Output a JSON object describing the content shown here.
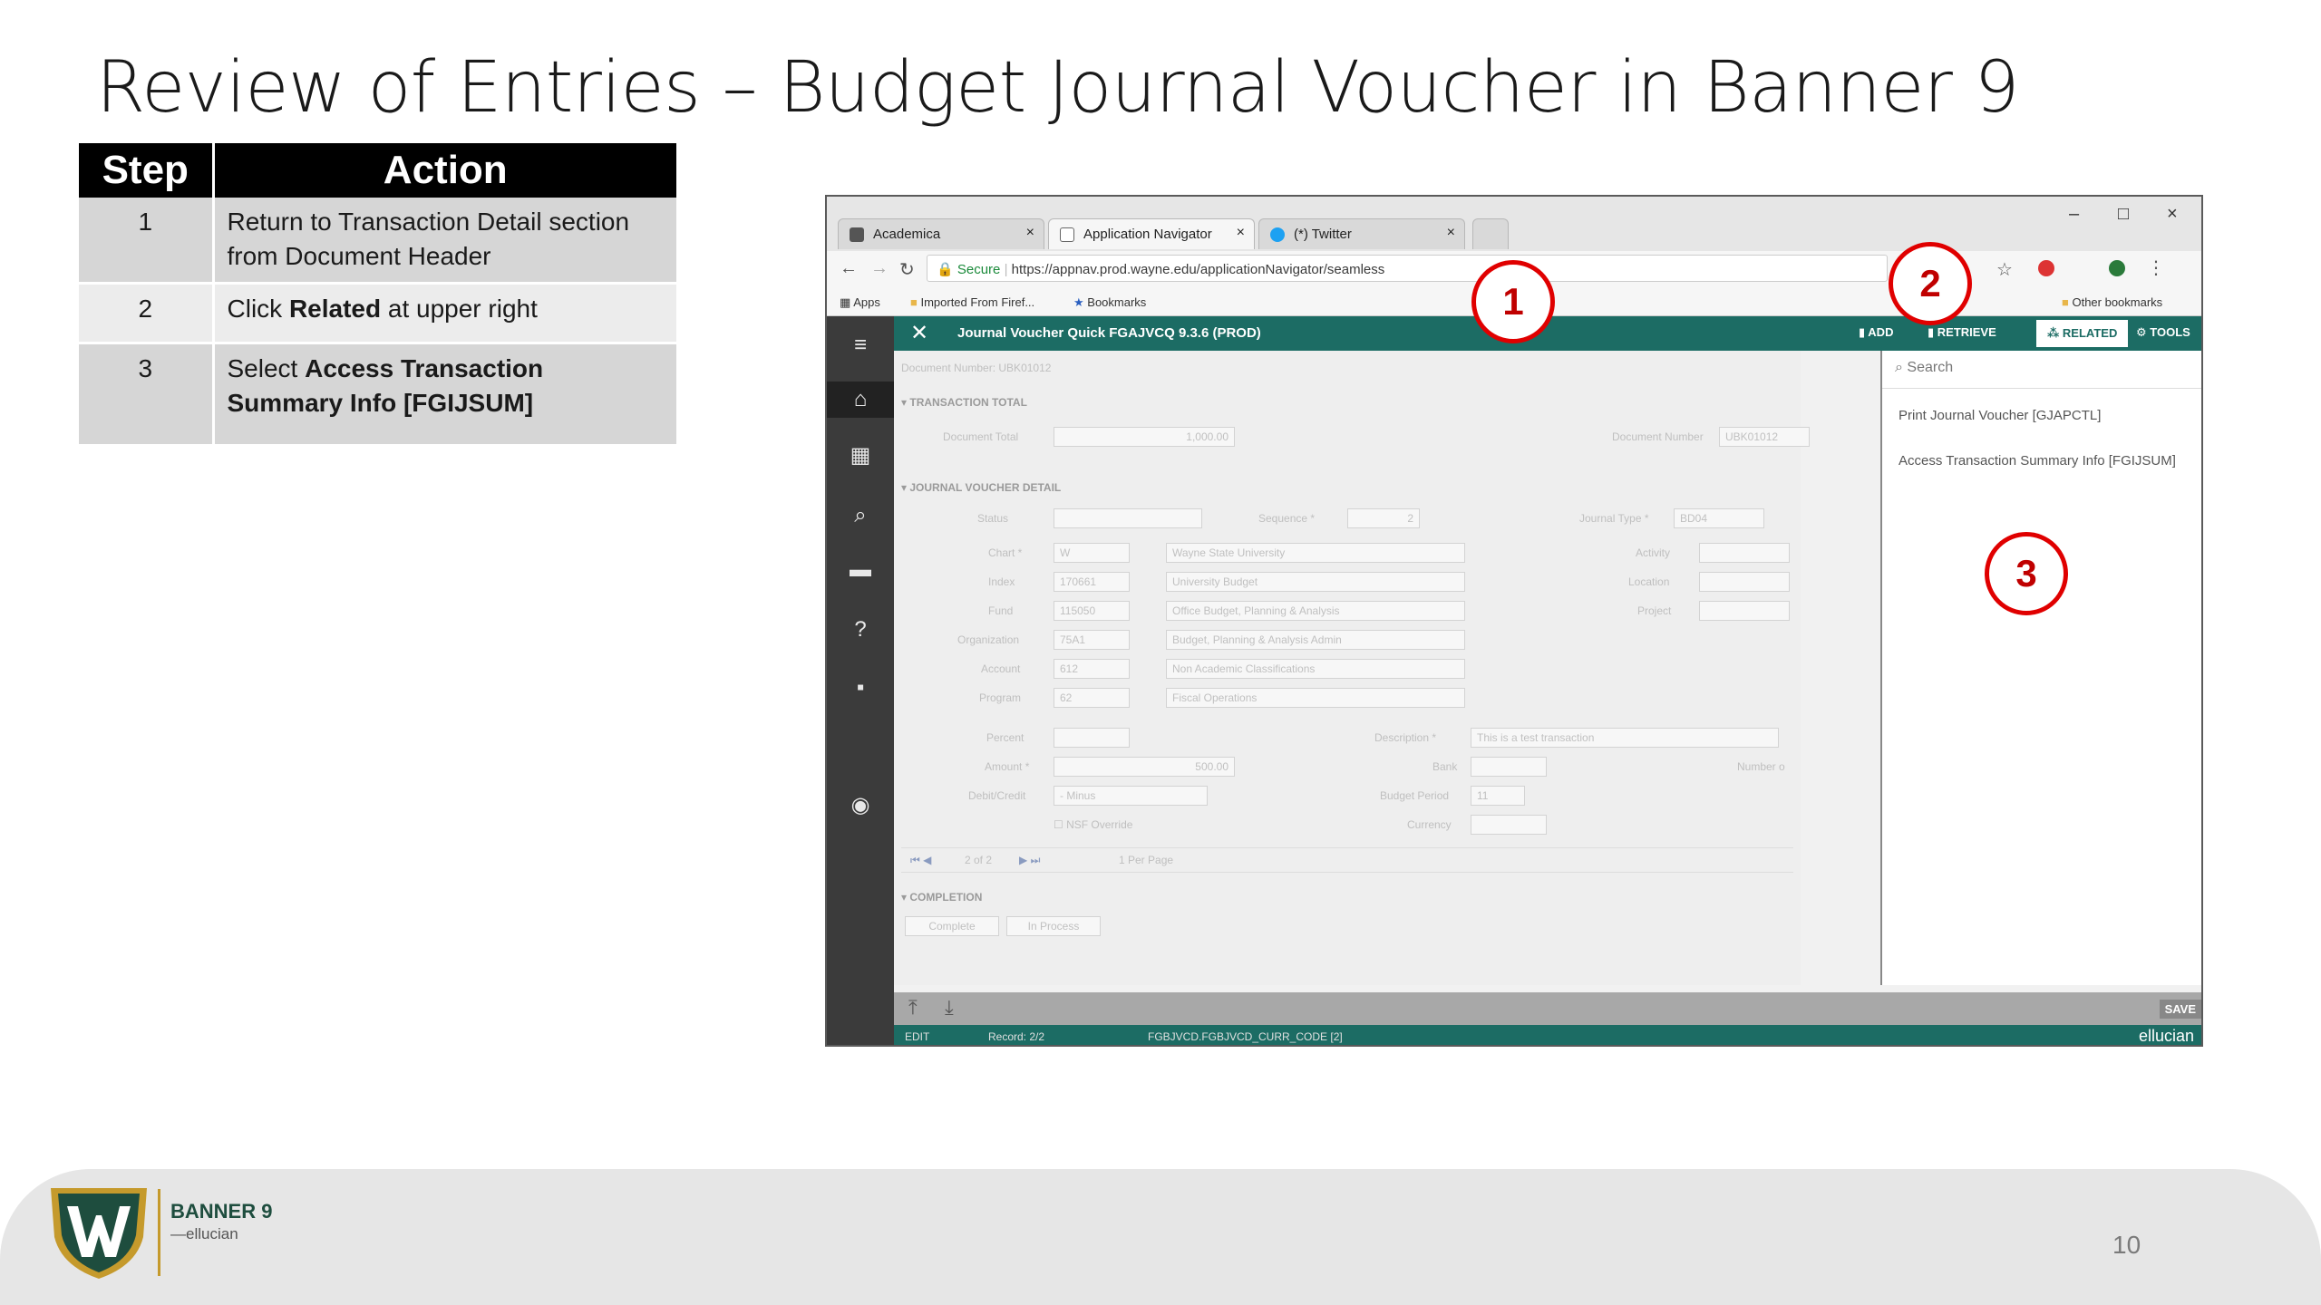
{
  "slide": {
    "title": "Review of Entries – Budget Journal Voucher in Banner 9",
    "page_number": "10"
  },
  "table": {
    "headers": {
      "step": "Step",
      "action": "Action"
    },
    "rows": [
      {
        "step": "1",
        "action": "Return to Transaction Detail section from Document Header"
      },
      {
        "step": "2",
        "action_pre": "Click ",
        "action_bold": "Related",
        "action_post": " at upper right"
      },
      {
        "step": "3",
        "action_pre": "Select ",
        "action_bold": "Access Transaction Summary Info [FGIJSUM]",
        "action_post": ""
      }
    ]
  },
  "browser": {
    "tabs": [
      {
        "label": "Academica",
        "icon": "academica-icon"
      },
      {
        "label": "Application Navigator",
        "icon": "document-icon"
      },
      {
        "label": "(*) Twitter",
        "icon": "twitter-icon"
      }
    ],
    "secure_label": "Secure",
    "url": "https://appnav.prod.wayne.edu/applicationNavigator/seamless",
    "bookmarks": [
      "Apps",
      "Imported From Firef...",
      "Bookmarks"
    ],
    "other_bookmarks": "Other bookmarks"
  },
  "app": {
    "title": "Journal Voucher Quick FGAJVCQ 9.3.6 (PROD)",
    "buttons": {
      "add": "ADD",
      "retrieve": "RETRIEVE",
      "related": "RELATED",
      "tools": "TOOLS"
    },
    "document_number_label": "Document Number:",
    "document_number": "UBK01012",
    "sections": {
      "total": "TRANSACTION TOTAL",
      "detail": "JOURNAL VOUCHER DETAIL",
      "completion": "COMPLETION"
    },
    "fields": {
      "document_total_label": "Document Total",
      "document_total": "1,000.00",
      "doc_number_label": "Document Number",
      "doc_number": "UBK01012",
      "status_label": "Status",
      "sequence_label": "Sequence *",
      "sequence": "2",
      "journal_type_label": "Journal Type *",
      "journal_type": "BD04",
      "chart_label": "Chart *",
      "chart": "W",
      "chart_desc": "Wayne State University",
      "index_label": "Index",
      "index": "170661",
      "index_desc": "University Budget",
      "fund_label": "Fund",
      "fund": "115050",
      "fund_desc": "Office Budget, Planning & Analysis",
      "org_label": "Organization",
      "org": "75A1",
      "org_desc": "Budget, Planning & Analysis Admin",
      "account_label": "Account",
      "account": "612",
      "account_desc": "Non Academic Classifications",
      "program_label": "Program",
      "program": "62",
      "program_desc": "Fiscal Operations",
      "activity_label": "Activity",
      "location_label": "Location",
      "project_label": "Project",
      "percent_label": "Percent",
      "amount_label": "Amount *",
      "amount": "500.00",
      "debit_label": "Debit/Credit",
      "debit": "- Minus",
      "nsf_label": "NSF Override",
      "description_label": "Description *",
      "description": "This is a test transaction",
      "bank_label": "Bank",
      "budget_period_label": "Budget Period",
      "budget_period": "11",
      "currency_label": "Currency",
      "number_label": "Number o",
      "pager": "2 of 2",
      "per_page": "1  Per Page",
      "complete_btn": "Complete",
      "in_process_btn": "In Process"
    },
    "related": {
      "search_placeholder": "Search",
      "items": [
        "Print Journal Voucher [GJAPCTL]",
        "Access Transaction Summary Info [FGIJSUM]"
      ]
    },
    "bottom": {
      "save": "SAVE"
    },
    "status": {
      "mode": "EDIT",
      "record": "Record: 2/2",
      "field": "FGBJVCD.FGBJVCD_CURR_CODE [2]",
      "brand": "ellucian"
    }
  },
  "callouts": [
    "1",
    "2",
    "3"
  ],
  "footer": {
    "banner": "BANNER 9",
    "ellucian": "ellucian"
  },
  "colors": {
    "accent_teal": "#1c6c64",
    "callout_red": "#e00000",
    "shield_green": "#1e4d3e",
    "shield_gold": "#c59a2c"
  }
}
